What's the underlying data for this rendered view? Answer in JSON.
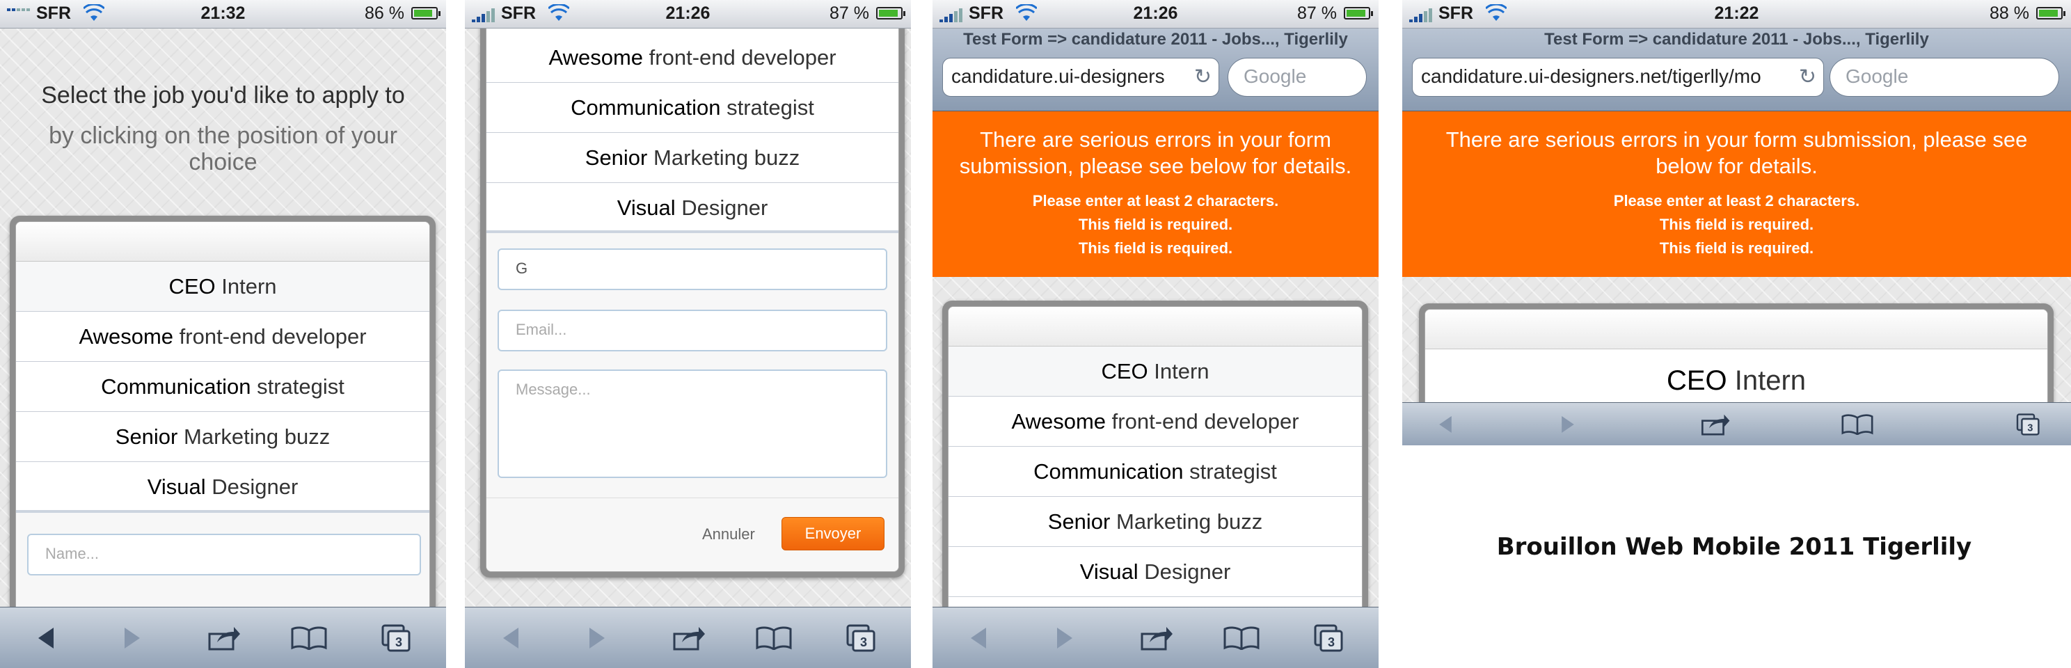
{
  "status_bars": [
    {
      "carrier": "SFR",
      "time": "21:32",
      "battery": "86 %",
      "battery_level": 0.86
    },
    {
      "carrier": "SFR",
      "time": "21:26",
      "battery": "87 %",
      "battery_level": 0.87
    },
    {
      "carrier": "SFR",
      "time": "21:26",
      "battery": "87 %",
      "battery_level": 0.87
    },
    {
      "carrier": "SFR",
      "time": "21:22",
      "battery": "88 %",
      "battery_level": 0.88
    }
  ],
  "screen1": {
    "heading": "Select the job you'd like to apply to",
    "subheading": "by clicking on the position of your choice",
    "name_placeholder": "Name..."
  },
  "jobs": [
    {
      "title": "CEO",
      "rest": "Intern"
    },
    {
      "title": "Awesome",
      "rest": "front-end developer"
    },
    {
      "title": "Communication",
      "rest": "strategist"
    },
    {
      "title": "Senior",
      "rest": "Marketing buzz"
    },
    {
      "title": "Visual",
      "rest": "Designer"
    }
  ],
  "screen2": {
    "name_value": "G",
    "email_placeholder": "Email...",
    "message_placeholder": "Message...",
    "cancel_label": "Annuler",
    "send_label": "Envoyer"
  },
  "safari": {
    "page_title": "Test Form => candidature 2011 - Jobs..., Tigerlily",
    "url_short": "candidature.ui-designers",
    "url_long": "candidature.ui-designers.net/tigerlly/mo",
    "search_placeholder": "Google",
    "tabs_count": "3"
  },
  "errors": {
    "title": "There are serious errors in your form submission, please see below for details.",
    "items": [
      "Please enter at least 2 characters.",
      "This field is required.",
      "This field is required."
    ]
  },
  "caption": "Brouillon Web Mobile 2011 Tigerlily",
  "colors": {
    "accent": "#ff6c00",
    "signal": "#1d4f9a",
    "battery": "#44b62d",
    "toolbar": "#93a3b7"
  }
}
